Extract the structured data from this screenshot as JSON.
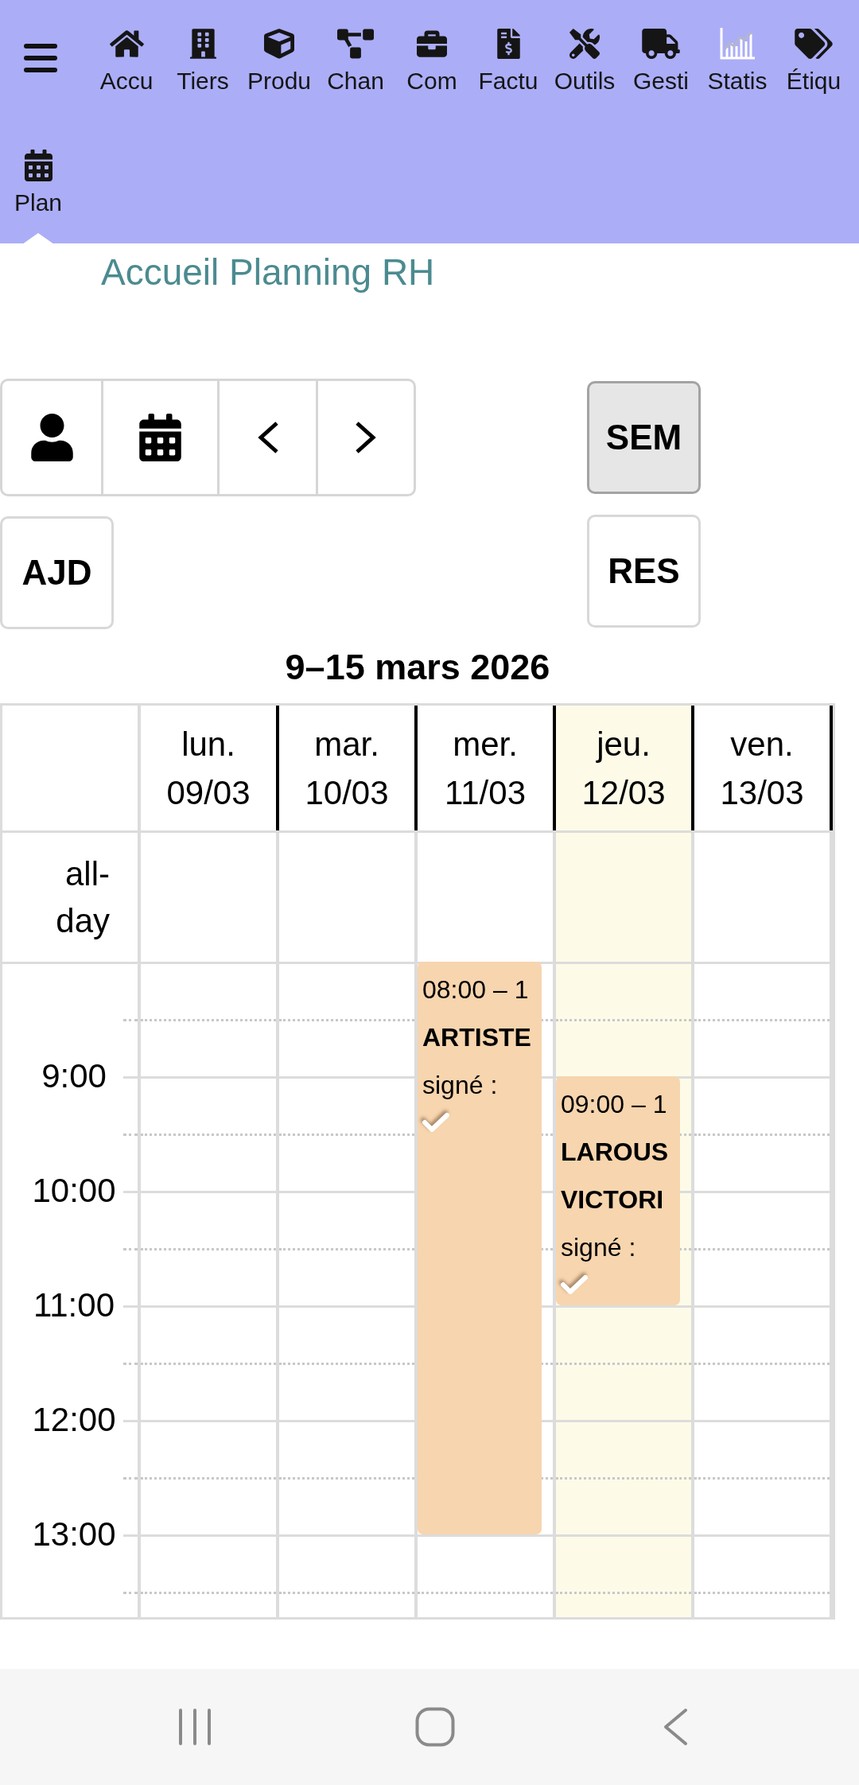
{
  "nav_bar": {
    "items": [
      {
        "label": "Accu",
        "selected": false
      },
      {
        "label": "Tiers",
        "selected": false
      },
      {
        "label": "Produ",
        "selected": false
      },
      {
        "label": "Chan",
        "selected": false
      },
      {
        "label": "Com",
        "selected": false
      },
      {
        "label": "Factu",
        "selected": false
      },
      {
        "label": "Outils",
        "selected": false
      },
      {
        "label": "Gesti",
        "selected": false
      },
      {
        "label": "Statis",
        "selected": false
      },
      {
        "label": "Étiqu",
        "selected": false
      },
      {
        "label": "Plan",
        "selected": true
      }
    ]
  },
  "page_title": "Accueil Planning RH",
  "toolbar": {
    "today_button": "AJD",
    "view_buttons": [
      {
        "label": "SEM",
        "selected": true
      },
      {
        "label": "RES",
        "selected": false
      }
    ]
  },
  "calendar": {
    "title": "9–15 mars 2026",
    "all_day_label": "all-day",
    "days": [
      {
        "weekday": "lun.",
        "date": "09/03",
        "today": false
      },
      {
        "weekday": "mar.",
        "date": "10/03",
        "today": false
      },
      {
        "weekday": "mer.",
        "date": "11/03",
        "today": false,
        "events": [
          {
            "time": "08:00 – 1",
            "title_lines": [
              "ARTISTE"
            ],
            "status_label": "signé :",
            "signed": true,
            "slots": [
              {
                "covered": true
              },
              {
                "covered": true
              },
              {
                "covered": true
              },
              {
                "covered": true
              },
              {
                "covered": true
              },
              {
                "covered": true
              },
              {
                "covered": true
              },
              {
                "covered": true
              },
              {
                "covered": true
              },
              {
                "covered": true
              },
              {
                "covered": false
              },
              {
                "covered": false
              }
            ]
          }
        ]
      },
      {
        "weekday": "jeu.",
        "date": "12/03",
        "today": true,
        "events": [
          {
            "time": "09:00 – 1",
            "title_lines": [
              "LAROUS",
              "VICTORI"
            ],
            "status_label": "signé :",
            "signed": true,
            "slots": [
              {
                "covered": false
              },
              {
                "covered": false
              },
              {
                "covered": true
              },
              {
                "covered": true
              },
              {
                "covered": true
              },
              {
                "covered": true
              },
              {
                "covered": false
              },
              {
                "covered": false
              },
              {
                "covered": false
              },
              {
                "covered": false
              },
              {
                "covered": false
              },
              {
                "covered": false
              }
            ]
          }
        ]
      },
      {
        "weekday": "ven.",
        "date": "13/03",
        "today": false
      }
    ],
    "time_slots": [
      {
        "kind": "hour"
      },
      {
        "kind": "half"
      },
      {
        "kind": "hour",
        "label": "9:00"
      },
      {
        "kind": "half"
      },
      {
        "kind": "hour",
        "label": "10:00"
      },
      {
        "kind": "half"
      },
      {
        "kind": "hour",
        "label": "11:00"
      },
      {
        "kind": "half"
      },
      {
        "kind": "hour",
        "label": "12:00"
      },
      {
        "kind": "half"
      },
      {
        "kind": "hour",
        "label": "13:00"
      },
      {
        "kind": "half"
      }
    ]
  }
}
